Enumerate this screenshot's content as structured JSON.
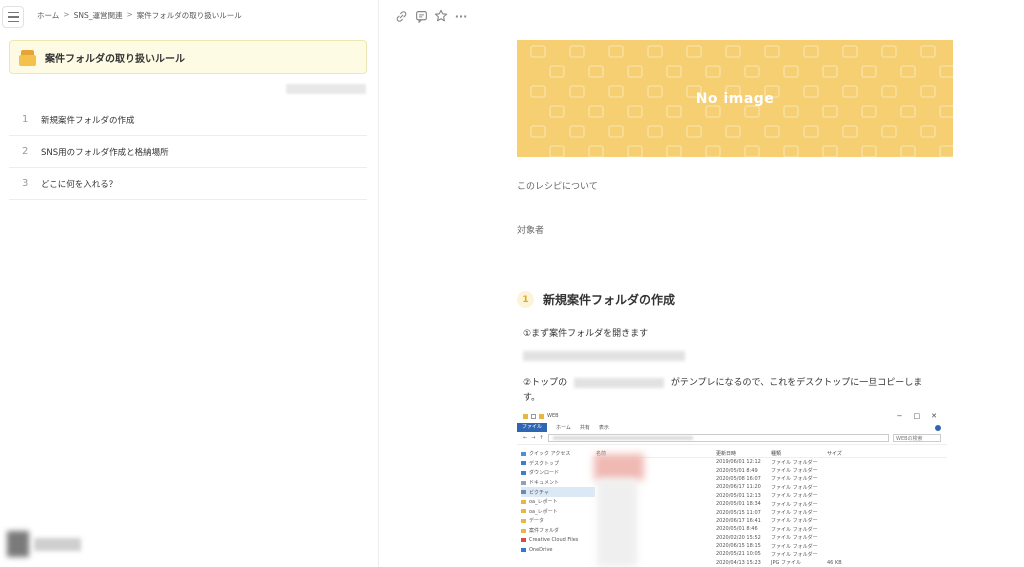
{
  "breadcrumb": {
    "items": [
      "ホーム",
      "SNS_運営関連",
      "案件フォルダの取り扱いルール"
    ],
    "separator": ">"
  },
  "left": {
    "title": "案件フォルダの取り扱いルール",
    "toc": [
      {
        "num": "1",
        "label": "新規案件フォルダの作成"
      },
      {
        "num": "2",
        "label": "SNS用のフォルダ作成と格納場所"
      },
      {
        "num": "3",
        "label": "どこに何を入れる？"
      }
    ]
  },
  "toolbar": {
    "icons": [
      "link-icon",
      "comment-icon",
      "star-icon",
      "more-icon"
    ],
    "more_label": "···"
  },
  "hero": {
    "text": "No image",
    "bg_color": "#f5cf72"
  },
  "recipe": {
    "about_label": "このレシピについて",
    "target_label": "対象者"
  },
  "step1": {
    "num": "1",
    "heading": "新規案件フォルダの作成",
    "line1": "①まず案件フォルダを開きます",
    "line2_a": "②トップの",
    "line2_b": "がテンプレになるので、これをデスクトップに一旦コピーしま",
    "line2_c": "す。"
  },
  "explorer": {
    "title": "WEB",
    "tabs": [
      "ファイル",
      "ホーム",
      "共有",
      "表示"
    ],
    "search_placeholder": "WEBの検索",
    "nav": [
      "クイック アクセス",
      "デスクトップ",
      "ダウンロード",
      "ドキュメント",
      "ピクチャ",
      "oa_レポート",
      "oa_レポート",
      "データ",
      "案件フォルダ",
      "Creative Cloud Files",
      "OneDrive"
    ],
    "columns": [
      "名前",
      "更新日時",
      "種類",
      "サイズ"
    ],
    "rows": [
      {
        "date": "2019/06/01 12:12",
        "type": "ファイル フォルダー",
        "size": ""
      },
      {
        "date": "2020/05/01 8:49",
        "type": "ファイル フォルダー",
        "size": ""
      },
      {
        "date": "2020/05/08 16:07",
        "type": "ファイル フォルダー",
        "size": ""
      },
      {
        "date": "2020/06/17 11:20",
        "type": "ファイル フォルダー",
        "size": ""
      },
      {
        "date": "2020/05/01 12:13",
        "type": "ファイル フォルダー",
        "size": ""
      },
      {
        "date": "2020/05/01 18:34",
        "type": "ファイル フォルダー",
        "size": ""
      },
      {
        "date": "2020/05/15 11:07",
        "type": "ファイル フォルダー",
        "size": ""
      },
      {
        "date": "2020/06/17 16:41",
        "type": "ファイル フォルダー",
        "size": ""
      },
      {
        "date": "2020/05/01 8:46",
        "type": "ファイル フォルダー",
        "size": ""
      },
      {
        "date": "2020/02/20 15:52",
        "type": "ファイル フォルダー",
        "size": ""
      },
      {
        "date": "2020/06/15 18:15",
        "type": "ファイル フォルダー",
        "size": ""
      },
      {
        "date": "2020/05/21 10:05",
        "type": "ファイル フォルダー",
        "size": ""
      },
      {
        "date": "2020/04/13 15:23",
        "type": "JPG ファイル",
        "size": "46 KB"
      }
    ]
  }
}
